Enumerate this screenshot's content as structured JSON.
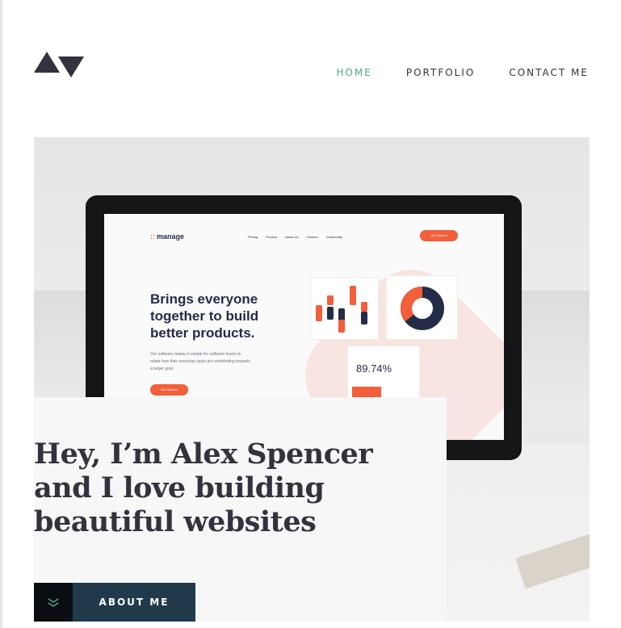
{
  "header": {
    "logo_icon": "av-logo-icon",
    "nav": [
      {
        "label": "HOME",
        "active": true
      },
      {
        "label": "PORTFOLIO",
        "active": false
      },
      {
        "label": "CONTACT ME",
        "active": false
      }
    ]
  },
  "hero": {
    "image": "monitor-showing-manage-website-photo",
    "mockup": {
      "brand": "manage",
      "nav": [
        "Pricing",
        "Product",
        "About Us",
        "Careers",
        "Community"
      ],
      "cta": "Get Started",
      "headline": "Brings everyone together to build better products.",
      "body": "Our software makes it simple for software teams to relate how their everyday tasks are contributing towards a larger goal.",
      "cta2": "Get Started",
      "stat": "89.74%"
    }
  },
  "intro": {
    "heading": "Hey, I’m Alex Spencer and I love building beautiful websites",
    "button_label": "ABOUT ME",
    "button_icon": "chevron-double-down-icon"
  },
  "colors": {
    "accent": "#4ea58f",
    "dark": "#33323d",
    "button": "#203a4c",
    "mockup_red": "#f25f3a"
  }
}
